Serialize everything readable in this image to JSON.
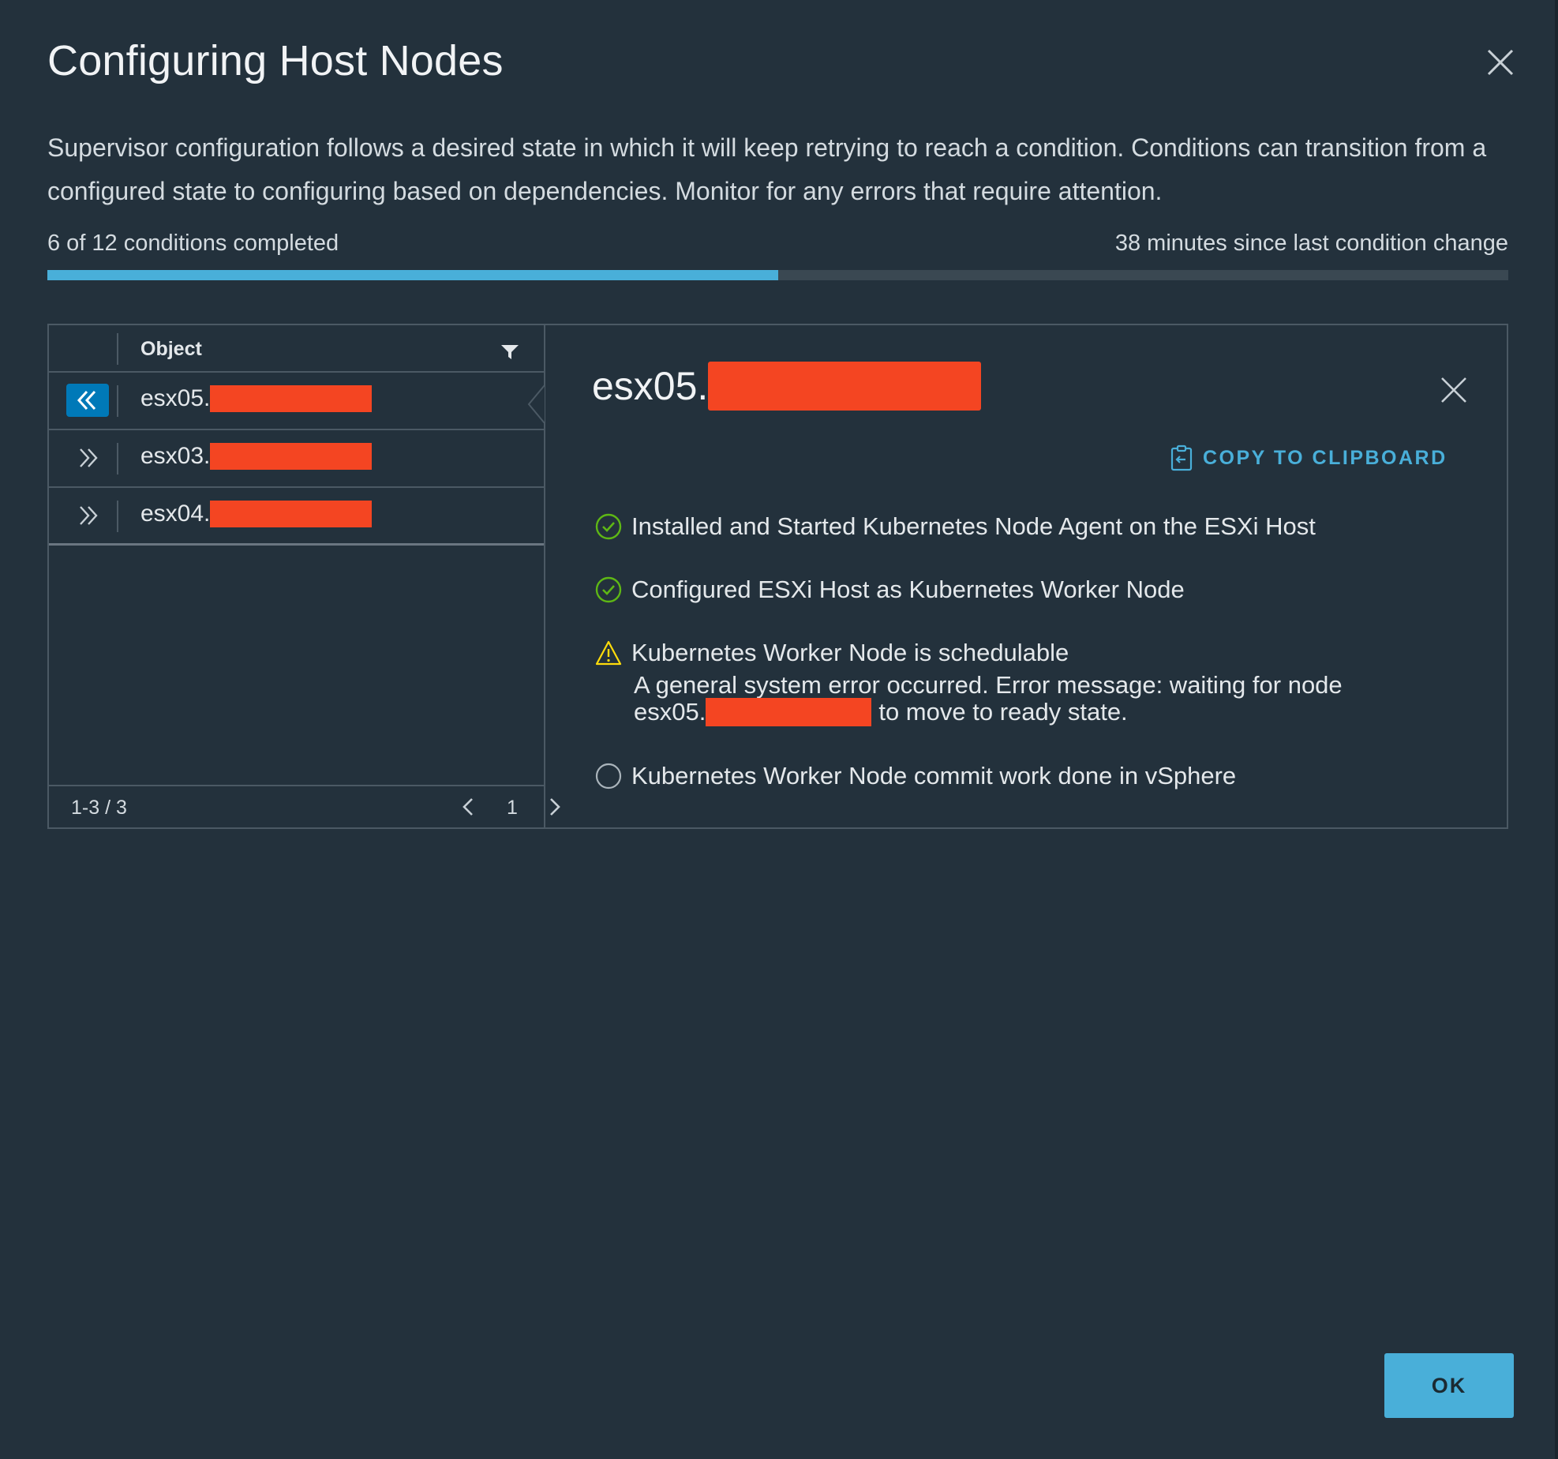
{
  "dialog": {
    "title": "Configuring Host Nodes",
    "description": "Supervisor configuration follows a desired state in which it will keep retrying to reach a condition. Conditions can transition from a configured state to configuring based on dependencies. Monitor for any errors that require attention.",
    "progress": {
      "completed_label": "6 of 12 conditions completed",
      "since_label": "38 minutes since last condition change",
      "completed": 6,
      "total": 12,
      "fill_fraction": 0.5
    },
    "ok_label": "OK"
  },
  "grid": {
    "column_header": "Object",
    "rows": [
      {
        "label": "esx05.",
        "expanded": true
      },
      {
        "label": "esx03.",
        "expanded": false
      },
      {
        "label": "esx04.",
        "expanded": false
      }
    ],
    "pagination": {
      "range": "1-3 / 3",
      "page": "1"
    }
  },
  "detail": {
    "title": "esx05.",
    "copy_label": "COPY TO CLIPBOARD",
    "conditions": [
      {
        "label": "Installed and Started Kubernetes Node Agent on the ESXi Host",
        "status": "success",
        "icon": "check-circle-icon"
      },
      {
        "label": "Configured ESXi Host as Kubernetes Worker Node",
        "status": "success",
        "icon": "check-circle-icon"
      },
      {
        "label": "Kubernetes Worker Node is schedulable",
        "status": "warning",
        "icon": "warning-triangle-icon",
        "message_line1": "A general system error occurred. Error message: waiting for node",
        "message_prefix": "esx05.",
        "message_suffix": "to move to ready state."
      },
      {
        "label": "Kubernetes Worker Node commit work done in vSphere",
        "status": "pending",
        "icon": "empty-circle-icon"
      }
    ]
  },
  "colors": {
    "background": "#23313c",
    "accent": "#49afd9",
    "success": "#5eb715",
    "warning": "#ffdc0b",
    "redaction": "#f44522",
    "selected_expander": "#0079b8"
  }
}
